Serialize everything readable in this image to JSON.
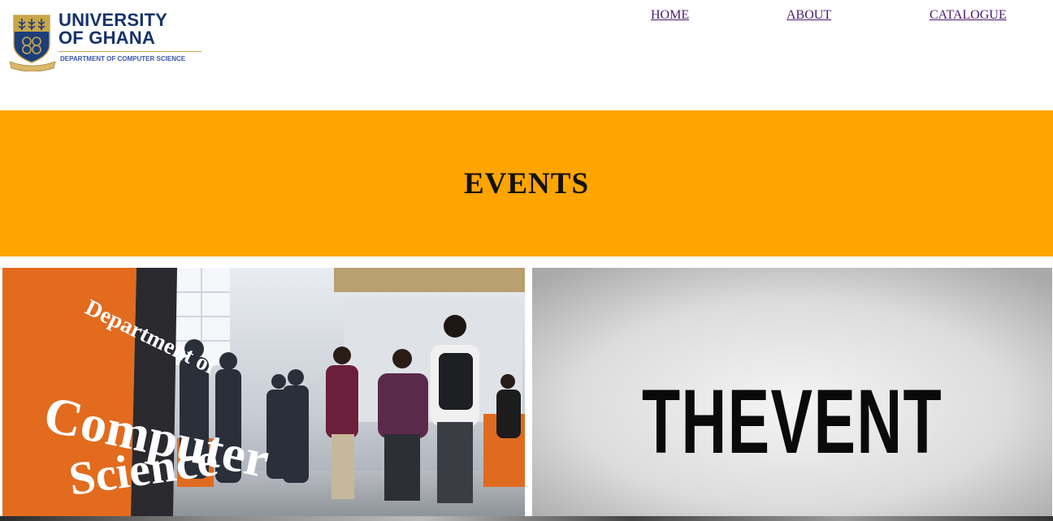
{
  "logo": {
    "name_line1": "UNIVERSITY",
    "name_line2": "OF GHANA",
    "department": "DEPARTMENT OF COMPUTER SCIENCE",
    "crest_icon": "university-crest-icon",
    "colors": {
      "navy": "#15336b",
      "gold": "#c9a64a",
      "dept_blue": "#3a55b5"
    }
  },
  "nav": {
    "items": [
      {
        "label": "HOME"
      },
      {
        "label": "ABOUT"
      },
      {
        "label": "CATALOGUE"
      }
    ],
    "link_color": "#4a1a6b"
  },
  "banner": {
    "title": "EVENTS",
    "background": "#ffa500"
  },
  "gallery": {
    "images": [
      {
        "name": "department-event-photo",
        "sign_line1": "Department of",
        "sign_line2": "Computer",
        "sign_line3": "Science"
      },
      {
        "name": "the-event-graphic",
        "text": "THEVENT"
      }
    ]
  }
}
